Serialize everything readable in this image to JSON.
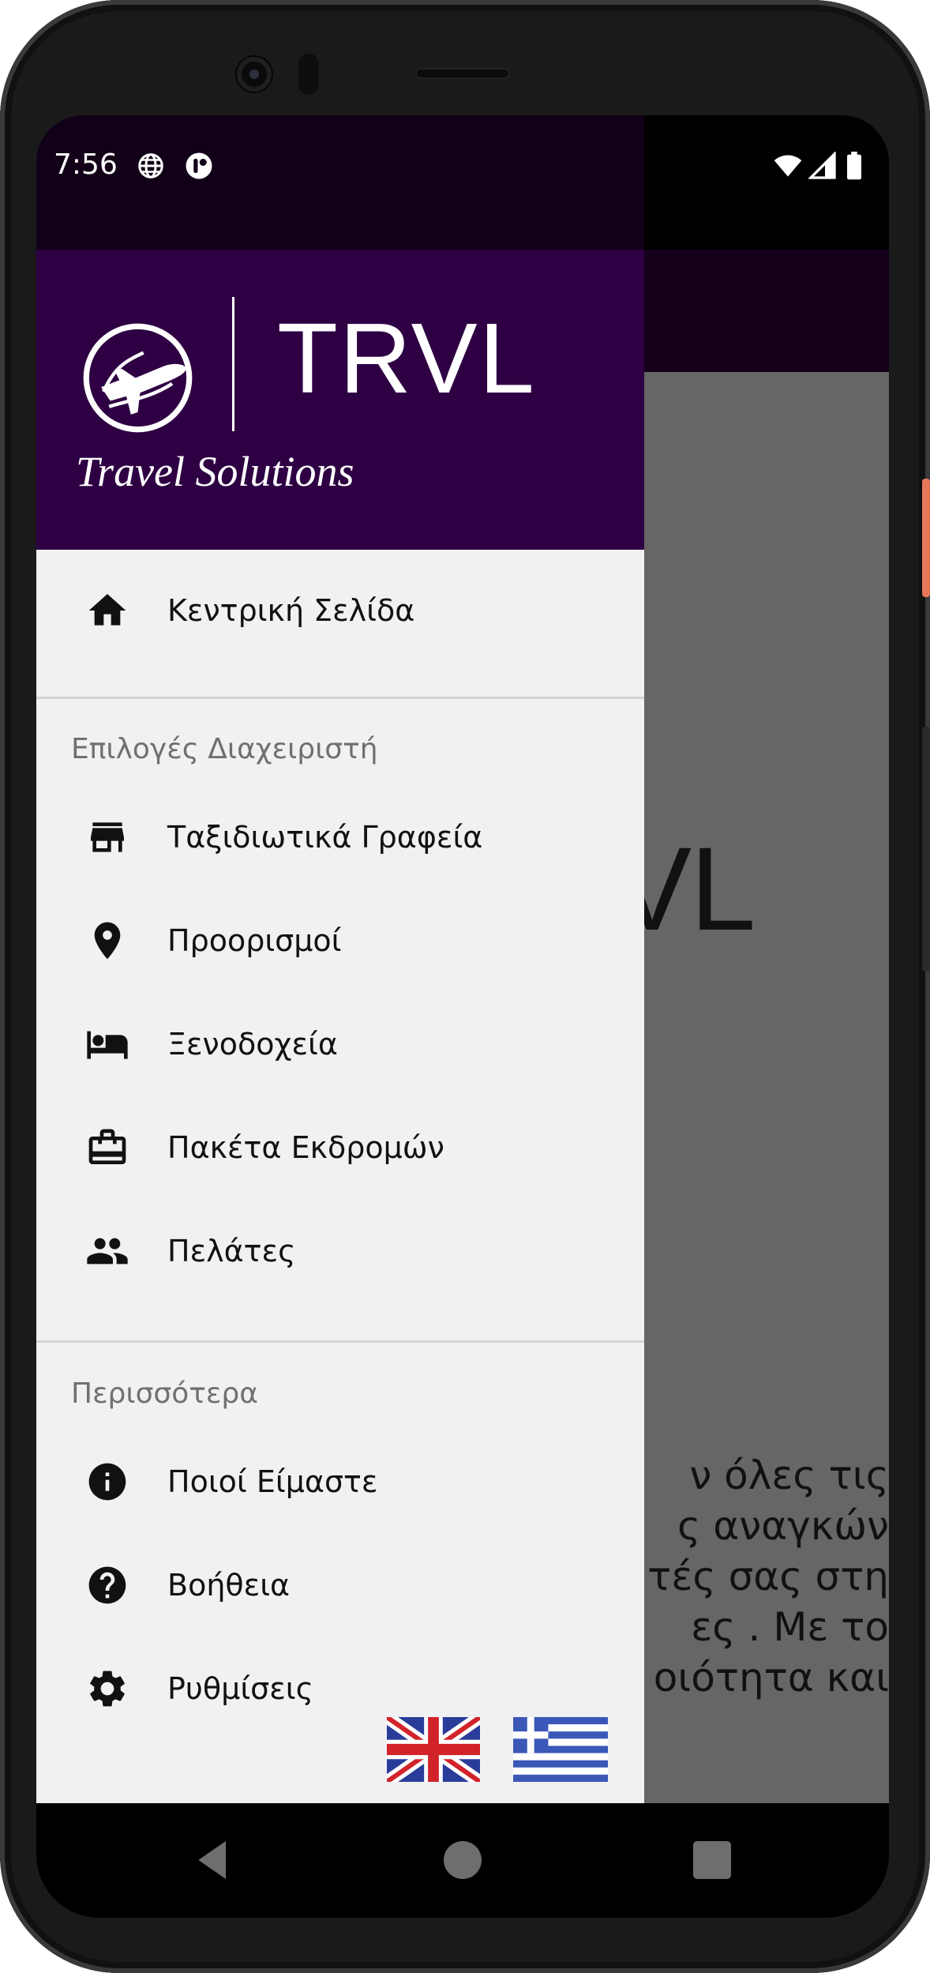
{
  "status_bar": {
    "time": "7:56",
    "left_icons": [
      "globe-icon",
      "app-notification-icon"
    ],
    "right_icons": [
      "wifi-icon",
      "signal-icon",
      "battery-icon"
    ]
  },
  "drawer": {
    "brand": {
      "name": "TRVL",
      "tagline": "Travel Solutions",
      "logo_icon": "airplane-globe-icon"
    },
    "home": {
      "label": "Κεντρική Σελίδα",
      "icon": "home-icon"
    },
    "admin_section": {
      "title": "Επιλογές Διαχειριστή",
      "items": [
        {
          "label": "Ταξιδιωτικά Γραφεία",
          "icon": "store-icon"
        },
        {
          "label": "Προορισμοί",
          "icon": "location-pin-icon"
        },
        {
          "label": "Ξενοδοχεία",
          "icon": "bed-icon"
        },
        {
          "label": "Πακέτα Εκδρομών",
          "icon": "briefcase-icon"
        },
        {
          "label": "Πελάτες",
          "icon": "people-icon"
        }
      ]
    },
    "more_section": {
      "title": "Περισσότερα",
      "items": [
        {
          "label": "Ποιοί Είμαστε",
          "icon": "info-icon"
        },
        {
          "label": "Βοήθεια",
          "icon": "help-icon"
        },
        {
          "label": "Ρυθμίσεις",
          "icon": "settings-icon"
        }
      ]
    },
    "languages": [
      "uk-flag-icon",
      "greece-flag-icon"
    ]
  },
  "background_app": {
    "logo_partial": "VL",
    "paragraph_lines": [
      "ν όλες τις",
      "ς αναγκών",
      "τές σας στη",
      "ες . Με το",
      "οιότητα και"
    ]
  },
  "colors": {
    "drawer_header": "#2e0043",
    "status_bar_drawer": "#120018",
    "drawer_bg": "#f1f1f3",
    "scrim": "#666666"
  }
}
